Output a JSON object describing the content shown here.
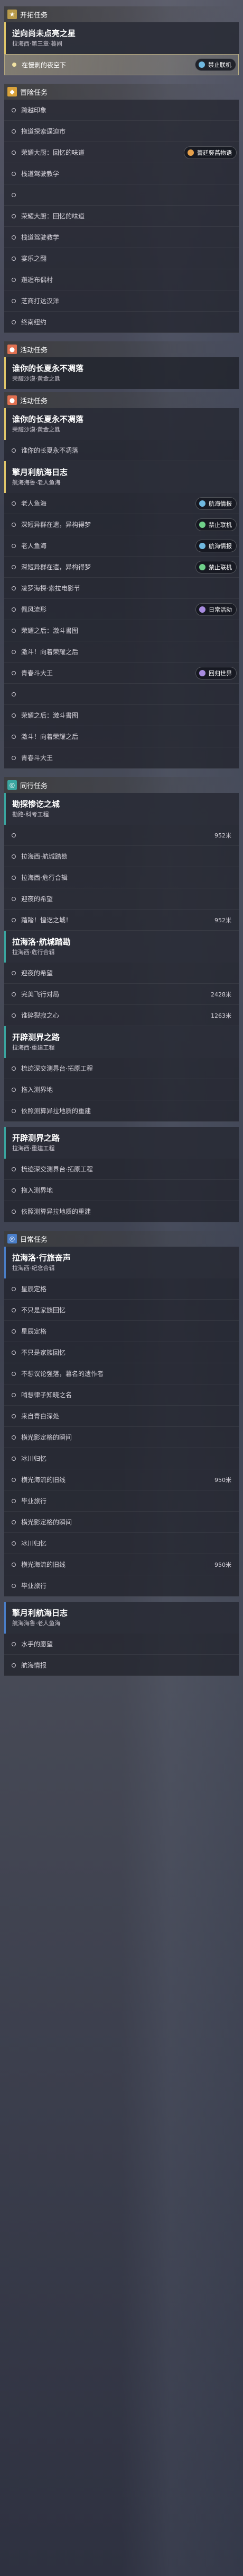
{
  "sections": {
    "main": {
      "badge": "★",
      "label": "开拓任务"
    },
    "side": {
      "badge": "◆",
      "label": "冒险任务"
    },
    "event1": {
      "badge": "●",
      "label": "活动任务"
    },
    "event2": {
      "badge": "●",
      "label": "活动任务"
    },
    "companion": {
      "badge": "◎",
      "label": "同行任务"
    },
    "daily": {
      "badge": "◎",
      "label": "日常任务"
    }
  },
  "main_quest": {
    "title": "逆向尚未点亮之星",
    "subtitle": "拉海西·第三章·暮间",
    "active_step": "在慢剥的夜空下",
    "tag": "禁止联机"
  },
  "side_steps": [
    "跨越印象",
    "拖道探索逼迫市",
    "荣耀大厨：回忆的味道",
    "栈道驾驶教学",
    "",
    "荣耀大厨：回忆的味道",
    "栈道驾驶教学",
    "宴乐之翻",
    "邂逅布偶村",
    "芝商打达汉洋",
    "终南纽约"
  ],
  "side_tag": "蕾廷竖菖物语",
  "event_quest": {
    "title": "谁你的长夏永不凋落",
    "subtitle": "荣耀沙漠·黄金之匙",
    "step": "谁你的长夏永不凋落"
  },
  "nav_quest": {
    "title": "擎月利航海日志",
    "subtitle": "航海海鲁·老人鱼海",
    "steps": [
      "老人鱼海",
      "深短异群在遗，异构得梦",
      "老人鱼海",
      "深短异群在遗，异构得梦",
      "凌罗海探·索拉电影节",
      "佩风流形",
      "荣耀之后：激斗書图",
      "激斗！向着荣耀之后",
      "青春斗大王",
      "",
      "荣耀之后：激斗書图",
      "激斗！向着荣耀之后",
      "青春斗大王"
    ],
    "tags": [
      "航海情报",
      "禁止联机",
      "航海情报",
      "禁止联机",
      "日常活动",
      "回归世界"
    ]
  },
  "companion_quest": {
    "title": "勘探惨讫之城",
    "subtitle": "勘路·科考工程",
    "steps": [
      {
        "t": "拉海西·航城踏勘",
        "d": ""
      },
      {
        "t": "拉海西·危行合辑",
        "d": ""
      },
      {
        "t": "迎夜的希望",
        "d": ""
      },
      {
        "t": "踏踏！惶讫之城！",
        "d": "952米"
      }
    ],
    "d0": "952米"
  },
  "quest4": {
    "title": "拉海洛·航城踏勘",
    "subtitle": "拉海西·危行合辑",
    "steps": [
      {
        "t": "迎夜的希望",
        "d": ""
      },
      {
        "t": "完美飞行对局",
        "d": "2428米"
      },
      {
        "t": "谁碎裂寂之心",
        "d": "1263米"
      }
    ]
  },
  "quest5": {
    "title": "开辟测界之路",
    "subtitle": "拉海西·重建工程",
    "steps": [
      "梳迹深交测界台·拓原工程",
      "拖入测界地",
      "依照测算异拉地质的重建"
    ]
  },
  "quest6": {
    "title": "开辟测界之路",
    "subtitle": "拉海西·重建工程",
    "steps": [
      "梳迹深交测界台·拓原工程",
      "拖入测界地",
      "依照测算异拉地质的重建"
    ]
  },
  "daily_quest": {
    "title": "拉海洛·行旅奋声",
    "subtitle": "拉海西·纪念合辑",
    "steps": [
      {
        "t": "星辰定格",
        "d": ""
      },
      {
        "t": "不只是家族回忆",
        "d": ""
      },
      {
        "t": "星辰定格",
        "d": ""
      },
      {
        "t": "不只是家族回忆",
        "d": ""
      },
      {
        "t": "不想议论强落，暮名的遗作者",
        "d": ""
      },
      {
        "t": "哨想律子知晓之名",
        "d": ""
      },
      {
        "t": "来自青白深处",
        "d": ""
      },
      {
        "t": "横光影定格的瞬间",
        "d": ""
      },
      {
        "t": "冰川归忆",
        "d": ""
      },
      {
        "t": "横光海流的旧线",
        "d": "950米"
      },
      {
        "t": "毕业旅行",
        "d": ""
      },
      {
        "t": "横光影定格的瞬间",
        "d": ""
      },
      {
        "t": "冰川归忆",
        "d": ""
      },
      {
        "t": "横光海流的旧线",
        "d": "950米"
      },
      {
        "t": "毕业旅行",
        "d": ""
      }
    ]
  },
  "last_quest": {
    "title": "擎月利航海日志",
    "subtitle": "航海海鲁·老人鱼海",
    "steps": [
      "水手的愿望",
      "航海情报"
    ]
  }
}
